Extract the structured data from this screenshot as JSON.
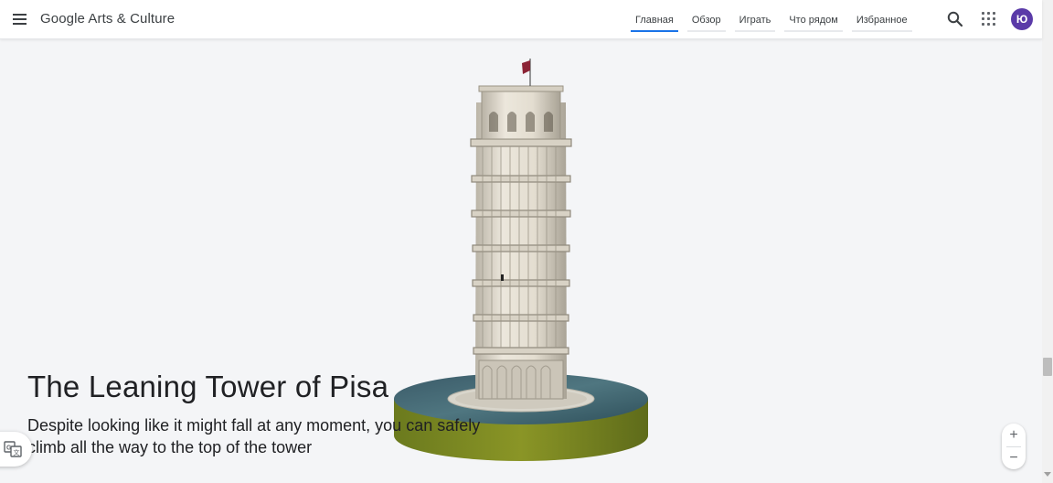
{
  "header": {
    "logo": "Google Arts & Culture",
    "tabs": [
      {
        "label": "Главная",
        "active": true
      },
      {
        "label": "Обзор",
        "active": false
      },
      {
        "label": "Играть",
        "active": false
      },
      {
        "label": "Что рядом",
        "active": false
      },
      {
        "label": "Избранное",
        "active": false
      }
    ],
    "avatar_initial": "Ю",
    "avatar_color": "#5a3aa8",
    "accent_color": "#1a73e8",
    "icons": [
      "menu-icon",
      "search-icon",
      "apps-grid-icon"
    ]
  },
  "main": {
    "title": "The Leaning Tower of Pisa",
    "subtitle": "Despite looking like it might fall at any moment, you can safely climb all the way to the top of the tower"
  },
  "controls": {
    "zoom_in": "+",
    "zoom_out": "−",
    "translate_icon": "translate-icon"
  }
}
